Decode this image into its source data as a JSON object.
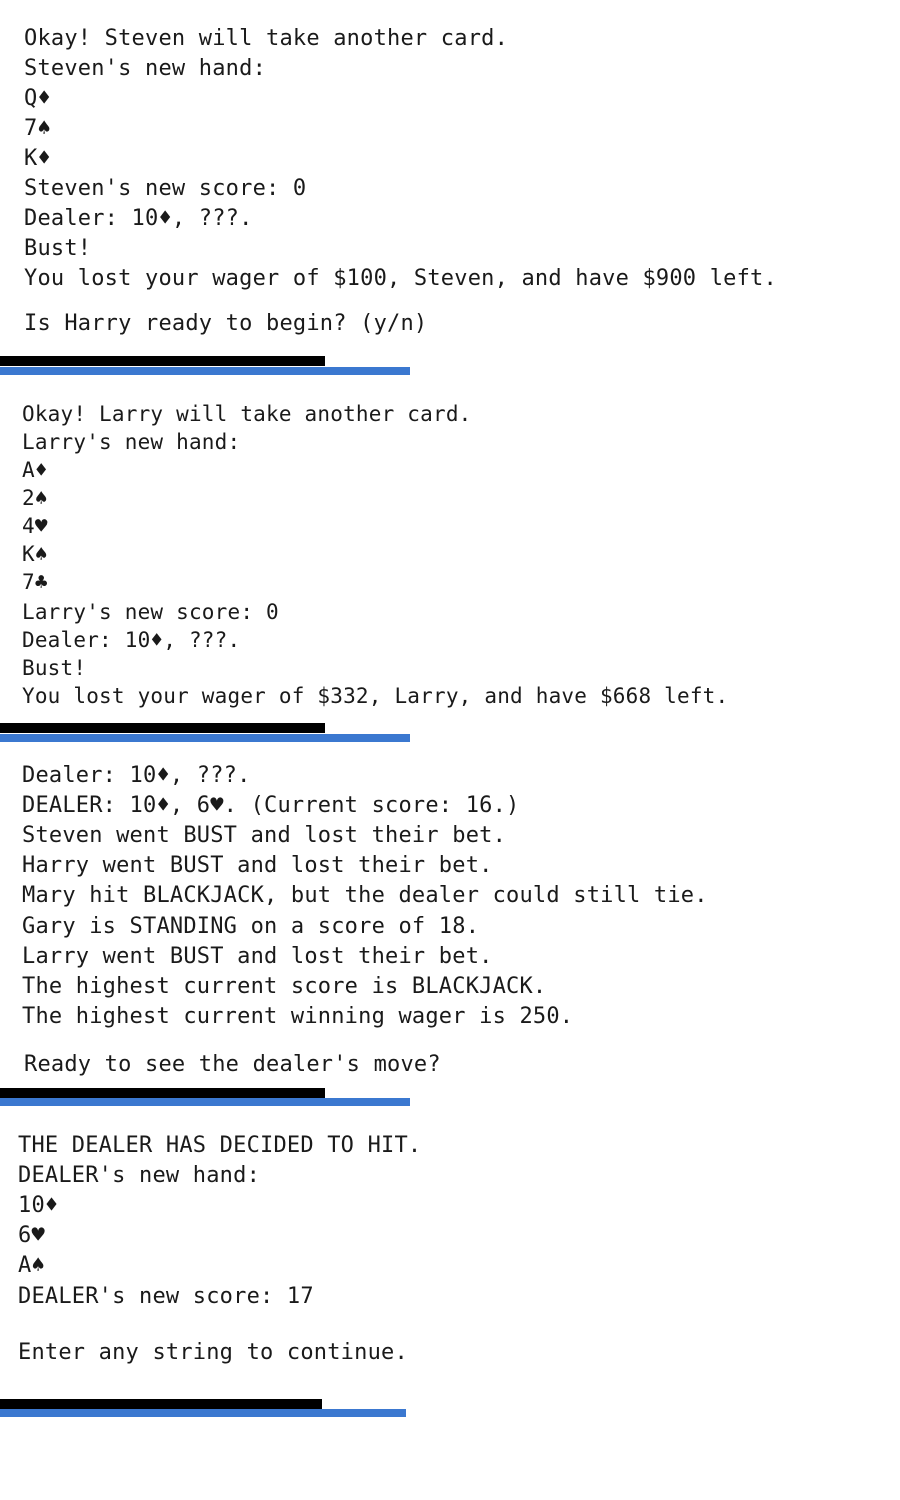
{
  "colors": {
    "divider_dark": "#000000",
    "divider_accent": "#3b78d0",
    "text": "#1a1a1a",
    "background": "#ffffff"
  },
  "panel1": {
    "lines": [
      "Okay! Steven will take another card.",
      "Steven's new hand:",
      "Q♦",
      "7♠",
      "K♦",
      "Steven's new score: 0",
      "Dealer: 10♦, ???.",
      "Bust!",
      "You lost your wager of $100, Steven, and have $900 left."
    ],
    "prompt": "Is Harry ready to begin? (y/n)"
  },
  "panel2": {
    "lines": [
      "Okay! Larry will take another card.",
      "Larry's new hand:",
      "A♦",
      "2♠",
      "4♥",
      "K♠",
      "7♣",
      "Larry's new score: 0",
      "Dealer: 10♦, ???.",
      "Bust!",
      "You lost your wager of $332, Larry, and have $668 left."
    ]
  },
  "panel3": {
    "lines": [
      "Dealer: 10♦, ???.",
      "DEALER: 10♦, 6♥. (Current score: 16.)",
      "Steven went BUST and lost their bet.",
      "Harry went BUST and lost their bet.",
      "Mary hit BLACKJACK, but the dealer could still tie.",
      "Gary is STANDING on a score of 18.",
      "Larry went BUST and lost their bet.",
      "The highest current score is BLACKJACK.",
      "The highest current winning wager is 250."
    ],
    "prompt": "Ready to see the dealer's move?"
  },
  "panel4": {
    "lines": [
      "THE DEALER HAS DECIDED TO HIT.",
      "DEALER's new hand:",
      "10♦",
      "6♥",
      "A♠",
      "DEALER's new score: 17"
    ],
    "prompt": "Enter any string to continue."
  }
}
